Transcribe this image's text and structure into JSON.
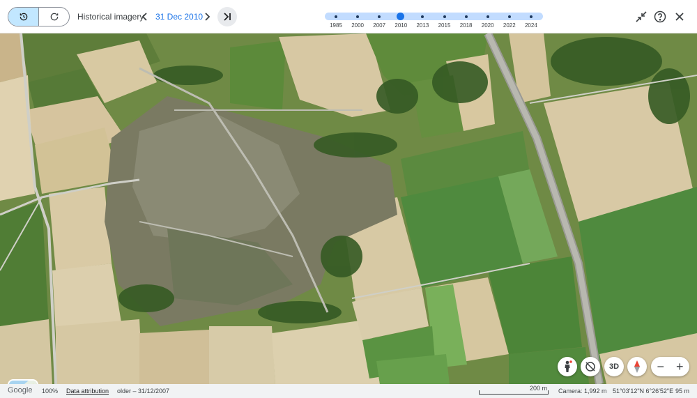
{
  "toolbar": {
    "history_icon": "history-icon",
    "refresh_icon": "refresh-icon",
    "title": "Historical imagery",
    "prev_icon": "chevron-left-icon",
    "date": "31 Dec 2010",
    "next_icon": "chevron-right-icon",
    "latest_icon": "skip-to-latest-icon",
    "exit_icon": "minimize-icon",
    "help_icon": "help-icon",
    "close_icon": "close-icon"
  },
  "timeline": {
    "years": [
      "1985",
      "2000",
      "2007",
      "2010",
      "2013",
      "2015",
      "2018",
      "2020",
      "2022",
      "2024"
    ],
    "selected": "2010",
    "accent": "#1a73e8",
    "track_color": "#c2dcff"
  },
  "controls": {
    "pegman_icon": "pegman-icon",
    "tilt_icon": "rotate-off-icon",
    "three_d_label": "3D",
    "compass_icon": "compass-icon",
    "zoom_out_label": "−",
    "zoom_in_label": "+"
  },
  "status": {
    "brand": "Google",
    "zoom": "100%",
    "attribution": "Data attribution",
    "imagery_note": "older – 31/12/2007",
    "scale": "200 m",
    "camera": "Camera: 1,992 m",
    "coordinates": "51°03'12\"N 6°26'52\"E",
    "elevation": "95 m"
  }
}
